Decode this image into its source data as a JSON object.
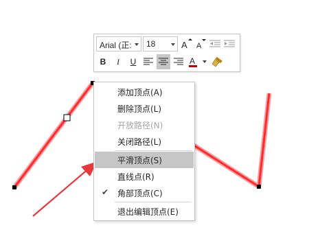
{
  "mini_toolbar": {
    "font_name": "Arial (正:",
    "font_size": "18",
    "grow_font_icon": "font-grow-icon",
    "shrink_font_icon": "font-shrink-icon",
    "decrease_indent_icon": "decrease-indent-icon",
    "increase_indent_icon": "increase-indent-icon",
    "bold_label": "B",
    "italic_label": "I",
    "underline_label": "U",
    "font_color": "#c00000",
    "format_painter_icon": "format-painter-icon"
  },
  "context_menu": {
    "items": [
      {
        "label": "添加顶点(A)"
      },
      {
        "label": "删除顶点(L)"
      },
      {
        "label": "开放路径(N)",
        "disabled": true
      },
      {
        "label": "关闭路径(L)"
      },
      {
        "label": "平滑顶点(S)",
        "highlighted": true
      },
      {
        "label": "直线点(R)"
      },
      {
        "label": "角部顶点(C)",
        "checked": true
      },
      {
        "label": "退出编辑顶点(E)"
      }
    ],
    "check_glyph": "✔"
  },
  "colors": {
    "path_red": "#ff2b2b",
    "highlight_gray": "#c6c6c6",
    "arrow_red": "#e8383d"
  }
}
